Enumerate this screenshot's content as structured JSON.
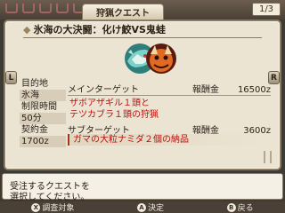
{
  "header": {
    "tab_label": "狩猟クエスト",
    "page_indicator": "1/3"
  },
  "quest": {
    "title": "氷海の大決闘：化け鮫VS鬼蛙",
    "monster_icons": [
      "zaboaza-icon",
      "tetsukabura-icon"
    ],
    "info": {
      "destination_label": "目的地",
      "destination_value": "氷海",
      "time_label": "制限時間",
      "time_value": "50分",
      "fee_label": "契約金",
      "fee_value": "1700z"
    },
    "main_target": {
      "label": "メインターゲット",
      "reward_label": "報酬金",
      "reward_value": "16500z",
      "line1": "ザボアザギル１頭と",
      "line2": "テツカブラ１頭の狩猟"
    },
    "sub_target": {
      "label": "サブターゲット",
      "reward_label": "報酬金",
      "reward_value": "3600z",
      "line1": "ガマの大粒ナミダ２個の納品"
    }
  },
  "message": {
    "line1": "受注するクエストを",
    "line2": "選択してください。"
  },
  "commands": [
    {
      "button": "X",
      "label": "調査対象"
    },
    {
      "button": "A",
      "label": "決定"
    },
    {
      "button": "B",
      "label": "戻る"
    }
  ],
  "nav": {
    "left": "L",
    "right": "R"
  },
  "colors": {
    "panel": "#ece4d3",
    "accent_red": "#b8100c",
    "frame": "#8c7b63"
  }
}
